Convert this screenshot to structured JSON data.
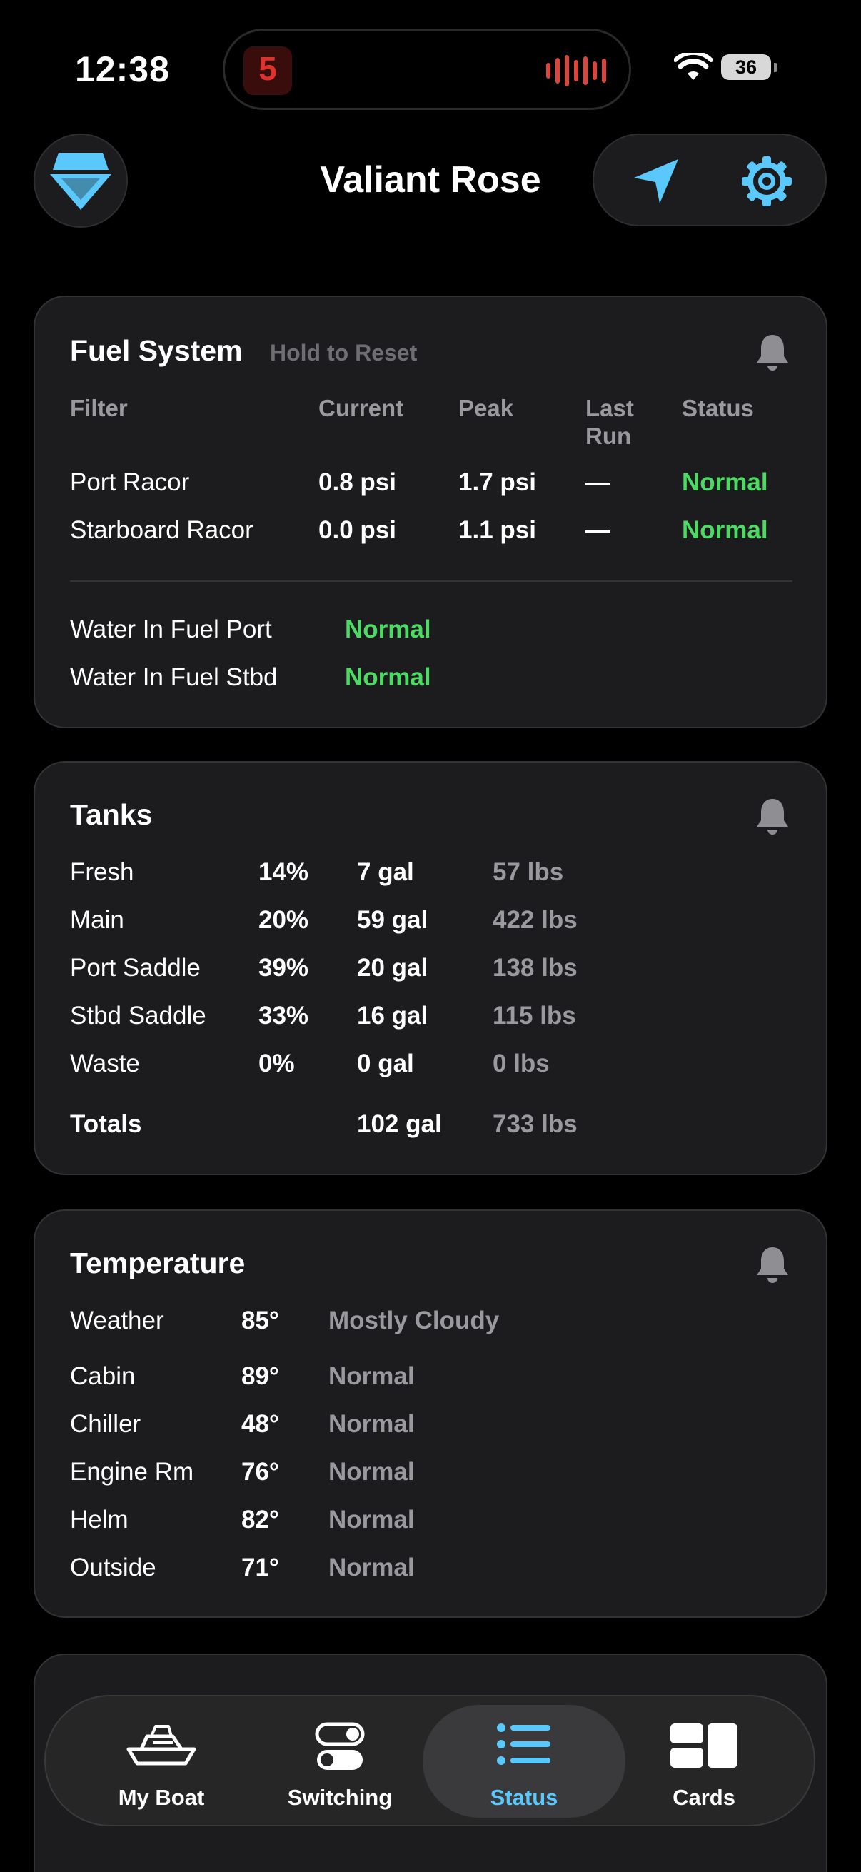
{
  "status_bar": {
    "time": "12:38",
    "battery": "36",
    "island_art_text": "5"
  },
  "header": {
    "title": "Valiant Rose"
  },
  "fuel": {
    "title": "Fuel System",
    "hint": "Hold to Reset",
    "columns": [
      "Filter",
      "Current",
      "Peak",
      "Last\nRun",
      "Status"
    ],
    "rows": [
      {
        "filter": "Port Racor",
        "current": "0.8 psi",
        "peak": "1.7 psi",
        "last": "—",
        "status": "Normal"
      },
      {
        "filter": "Starboard Racor",
        "current": "0.0 psi",
        "peak": "1.1 psi",
        "last": "—",
        "status": "Normal"
      }
    ],
    "water": [
      {
        "label": "Water In Fuel Port",
        "status": "Normal"
      },
      {
        "label": "Water In Fuel Stbd",
        "status": "Normal"
      }
    ]
  },
  "tanks": {
    "title": "Tanks",
    "rows": [
      {
        "name": "Fresh",
        "pct": "14%",
        "gal": "7 gal",
        "lbs": "57 lbs"
      },
      {
        "name": "Main",
        "pct": "20%",
        "gal": "59 gal",
        "lbs": "422 lbs"
      },
      {
        "name": "Port Saddle",
        "pct": "39%",
        "gal": "20 gal",
        "lbs": "138 lbs"
      },
      {
        "name": "Stbd Saddle",
        "pct": "33%",
        "gal": "16 gal",
        "lbs": "115 lbs"
      },
      {
        "name": "Waste",
        "pct": "0%",
        "gal": "0 gal",
        "lbs": "0 lbs"
      }
    ],
    "totals": {
      "label": "Totals",
      "gal": "102 gal",
      "lbs": "733 lbs"
    }
  },
  "temperature": {
    "title": "Temperature",
    "weather": {
      "label": "Weather",
      "value": "85°",
      "status": "Mostly Cloudy"
    },
    "rows": [
      {
        "name": "Cabin",
        "value": "89°",
        "status": "Normal"
      },
      {
        "name": "Chiller",
        "value": "48°",
        "status": "Normal"
      },
      {
        "name": "Engine Rm",
        "value": "76°",
        "status": "Normal"
      },
      {
        "name": "Helm",
        "value": "82°",
        "status": "Normal"
      },
      {
        "name": "Outside",
        "value": "71°",
        "status": "Normal"
      }
    ]
  },
  "tabs": [
    {
      "label": "My Boat",
      "icon": "boat-icon",
      "active": false
    },
    {
      "label": "Switching",
      "icon": "toggles-icon",
      "active": false
    },
    {
      "label": "Status",
      "icon": "list-icon",
      "active": true
    },
    {
      "label": "Cards",
      "icon": "cards-icon",
      "active": false
    }
  ],
  "colors": {
    "accent": "#5ac8fa",
    "normal": "#4cd964",
    "card": "#1c1c1e",
    "muted": "#9a9a9e"
  }
}
